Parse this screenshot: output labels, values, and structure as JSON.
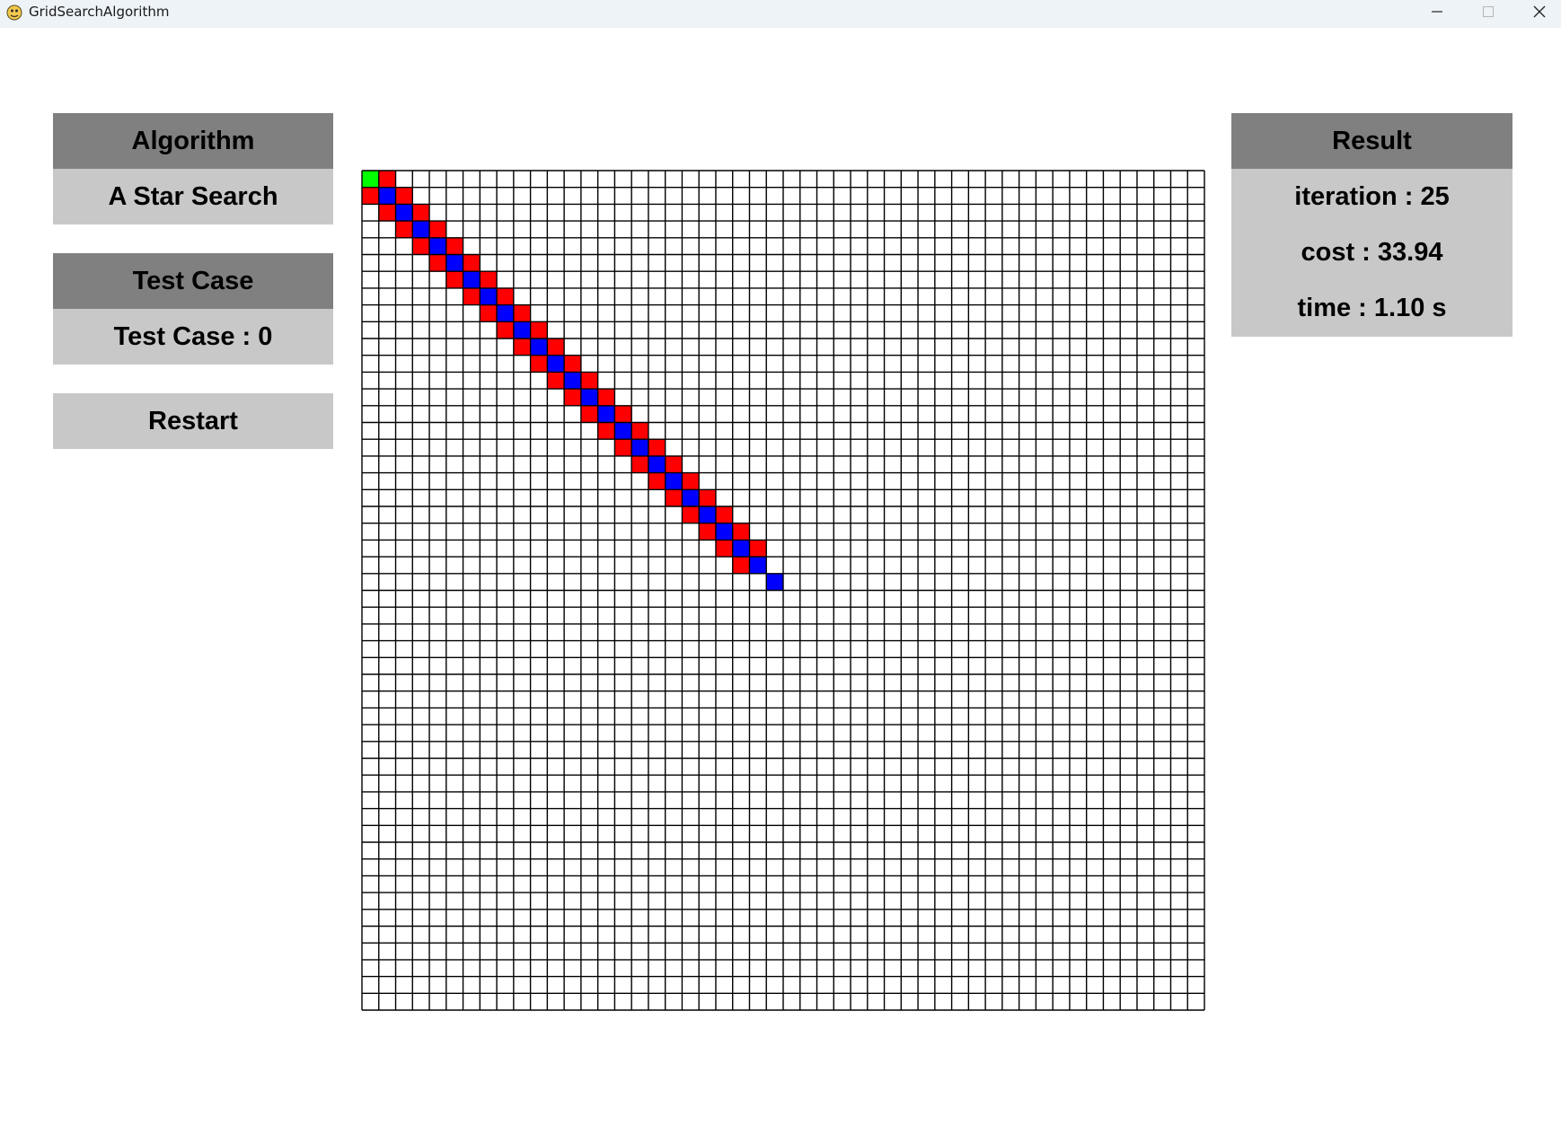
{
  "window": {
    "title": "GridSearchAlgorithm",
    "app_icon": "pygame-snake-icon",
    "controls": [
      "minimize-icon",
      "maximize-icon",
      "close-icon"
    ]
  },
  "algorithm_panel": {
    "header": "Algorithm",
    "value": "A Star Search"
  },
  "test_case_panel": {
    "header": "Test Case",
    "value": "Test Case : 0"
  },
  "restart_button": {
    "label": "Restart"
  },
  "result_panel": {
    "header": "Result",
    "iteration": "iteration : 25",
    "cost": "cost : 33.94",
    "time": "time : 1.10 s"
  },
  "grid": {
    "rows": 50,
    "cols": 50,
    "colors": {
      "empty": "#ffffff",
      "line": "#000000",
      "start": "#00ff00",
      "explored": "#ff0000",
      "path": "#0000ff"
    },
    "start": [
      0,
      0
    ],
    "path_cells": [
      [
        1,
        1
      ],
      [
        2,
        2
      ],
      [
        3,
        3
      ],
      [
        4,
        4
      ],
      [
        5,
        5
      ],
      [
        6,
        6
      ],
      [
        7,
        7
      ],
      [
        8,
        8
      ],
      [
        9,
        9
      ],
      [
        10,
        10
      ],
      [
        11,
        11
      ],
      [
        12,
        12
      ],
      [
        13,
        13
      ],
      [
        14,
        14
      ],
      [
        15,
        15
      ],
      [
        16,
        16
      ],
      [
        17,
        17
      ],
      [
        18,
        18
      ],
      [
        19,
        19
      ],
      [
        20,
        20
      ],
      [
        21,
        21
      ],
      [
        22,
        22
      ],
      [
        23,
        23
      ],
      [
        24,
        24
      ]
    ],
    "explored_rule": "cells adjacent (dr = ±1, same diagonal band) to the path from (0,1)/(1,0) through (23,22)/(22,23)"
  }
}
